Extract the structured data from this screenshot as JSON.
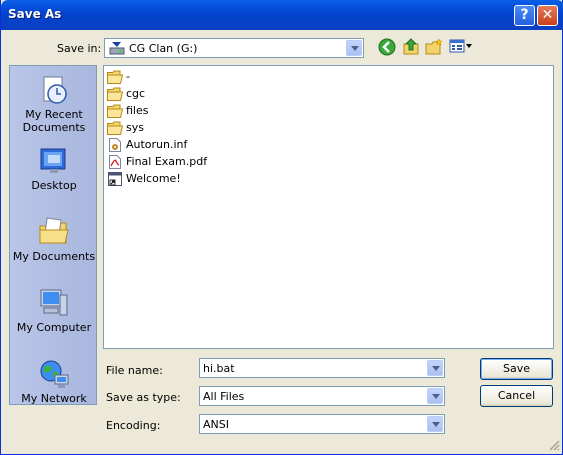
{
  "window": {
    "title": "Save As",
    "help_label": "?",
    "close_label": "✕"
  },
  "toolbar": {
    "save_in_label": "Save in:",
    "save_in_value": "CG Clan (G:)",
    "icons": [
      "back-icon",
      "up-folder-icon",
      "new-folder-icon",
      "views-menu-icon"
    ]
  },
  "places": [
    {
      "label": "My Recent\nDocuments",
      "icon": "recent-documents-icon"
    },
    {
      "label": "Desktop",
      "icon": "desktop-icon"
    },
    {
      "label": "My Documents",
      "icon": "my-documents-icon"
    },
    {
      "label": "My Computer",
      "icon": "my-computer-icon"
    },
    {
      "label": "My Network",
      "icon": "my-network-icon"
    }
  ],
  "files": [
    {
      "name": "-",
      "type": "folder"
    },
    {
      "name": "cgc",
      "type": "folder"
    },
    {
      "name": "files",
      "type": "folder"
    },
    {
      "name": "sys",
      "type": "folder"
    },
    {
      "name": "Autorun.inf",
      "type": "inf"
    },
    {
      "name": "Final Exam.pdf",
      "type": "pdf"
    },
    {
      "name": "Welcome!",
      "type": "shortcut"
    }
  ],
  "form": {
    "file_name_label": "File name:",
    "file_name_value": "hi.bat",
    "save_type_label": "Save as type:",
    "save_type_value": "All Files",
    "encoding_label": "Encoding:",
    "encoding_value": "ANSI"
  },
  "buttons": {
    "save_label": "Save",
    "cancel_label": "Cancel"
  }
}
